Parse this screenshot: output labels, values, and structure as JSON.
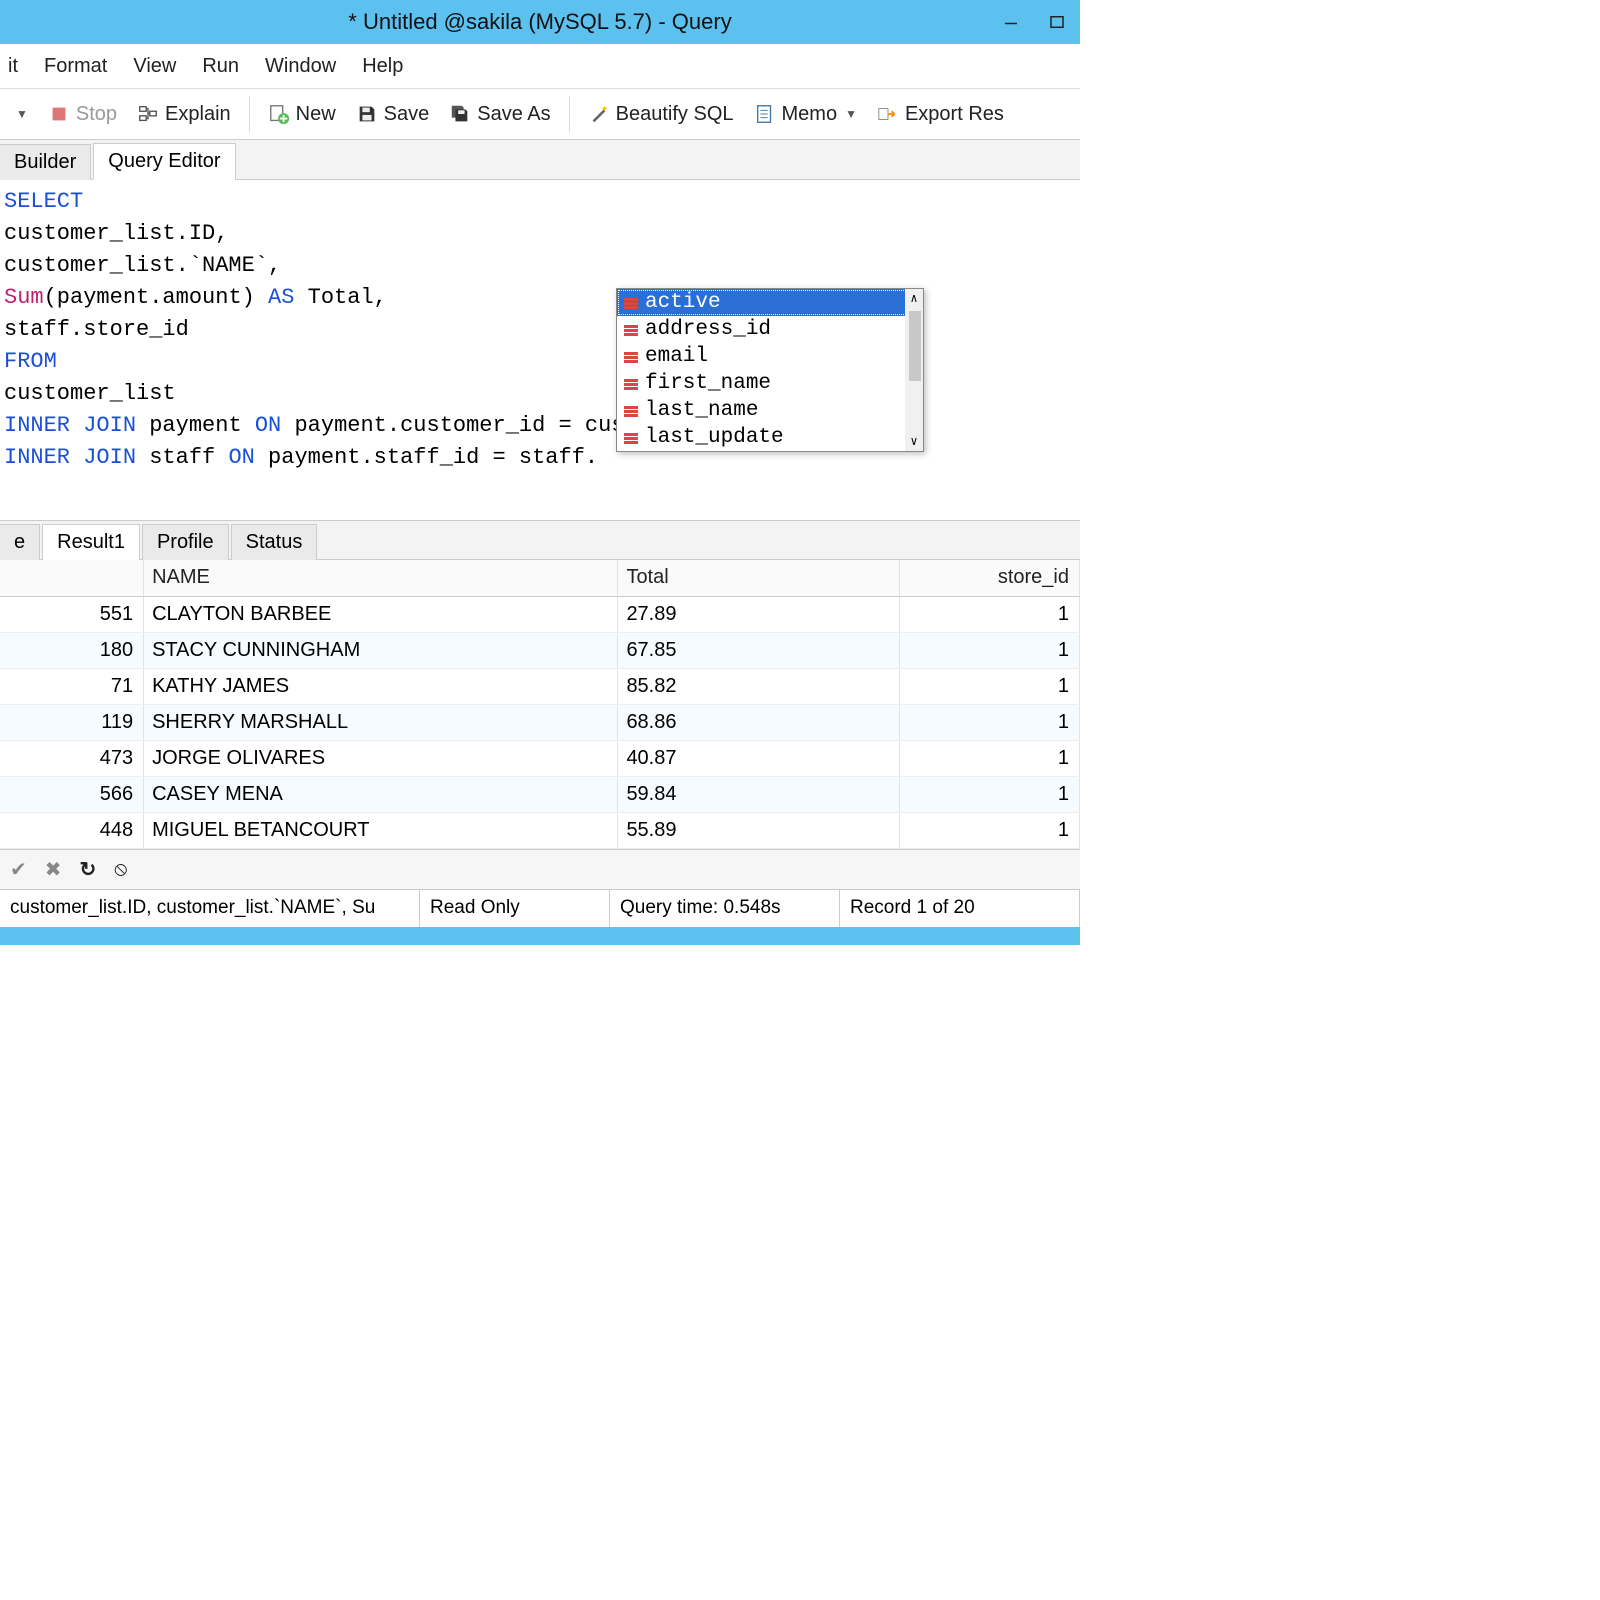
{
  "window": {
    "title": "* Untitled @sakila (MySQL 5.7) - Query"
  },
  "menubar": [
    "it",
    "Format",
    "View",
    "Run",
    "Window",
    "Help"
  ],
  "toolbar": {
    "stop": "Stop",
    "explain": "Explain",
    "new": "New",
    "save": "Save",
    "saveas": "Save As",
    "beautify": "Beautify SQL",
    "memo": "Memo",
    "export": "Export Res"
  },
  "editor_tabs": {
    "builder": "Builder",
    "editor": "Query Editor"
  },
  "sql_lines": [
    [
      {
        "t": "SELECT",
        "c": "kw"
      }
    ],
    [
      {
        "t": "customer_list.ID,",
        "c": ""
      }
    ],
    [
      {
        "t": "customer_list.`NAME`,",
        "c": ""
      }
    ],
    [
      {
        "t": "Sum",
        "c": "fn"
      },
      {
        "t": "(payment.amount) ",
        "c": ""
      },
      {
        "t": "AS",
        "c": "kw"
      },
      {
        "t": " Total,",
        "c": ""
      }
    ],
    [
      {
        "t": "staff.store_id",
        "c": ""
      }
    ],
    [
      {
        "t": "FROM",
        "c": "kw"
      }
    ],
    [
      {
        "t": "customer_list",
        "c": ""
      }
    ],
    [
      {
        "t": "INNER JOIN",
        "c": "kw"
      },
      {
        "t": " payment ",
        "c": ""
      },
      {
        "t": "ON",
        "c": "kw"
      },
      {
        "t": " payment.customer_id = customer_list.ID",
        "c": ""
      }
    ],
    [
      {
        "t": "INNER JOIN",
        "c": "kw"
      },
      {
        "t": " staff ",
        "c": ""
      },
      {
        "t": "ON",
        "c": "kw"
      },
      {
        "t": " payment.staff_id = staff.",
        "c": ""
      }
    ]
  ],
  "autocomplete": {
    "items": [
      "active",
      "address_id",
      "email",
      "first_name",
      "last_name",
      "last_update"
    ],
    "selected_index": 0
  },
  "result_tabs": [
    "e",
    "Result1",
    "Profile",
    "Status"
  ],
  "grid": {
    "columns": [
      "",
      "NAME",
      "Total",
      "store_id"
    ],
    "rows": [
      {
        "id": "551",
        "name": "CLAYTON BARBEE",
        "total": "27.89",
        "store_id": "1"
      },
      {
        "id": "180",
        "name": "STACY CUNNINGHAM",
        "total": "67.85",
        "store_id": "1"
      },
      {
        "id": "71",
        "name": "KATHY JAMES",
        "total": "85.82",
        "store_id": "1"
      },
      {
        "id": "119",
        "name": "SHERRY MARSHALL",
        "total": "68.86",
        "store_id": "1"
      },
      {
        "id": "473",
        "name": "JORGE OLIVARES",
        "total": "40.87",
        "store_id": "1"
      },
      {
        "id": "566",
        "name": "CASEY MENA",
        "total": "59.84",
        "store_id": "1"
      },
      {
        "id": "448",
        "name": "MIGUEL BETANCOURT",
        "total": "55.89",
        "store_id": "1"
      }
    ]
  },
  "statusbar": {
    "sql_preview": "customer_list.ID, customer_list.`NAME`, Su",
    "readonly": "Read Only",
    "querytime": "Query time: 0.548s",
    "record": "Record 1 of 20"
  }
}
